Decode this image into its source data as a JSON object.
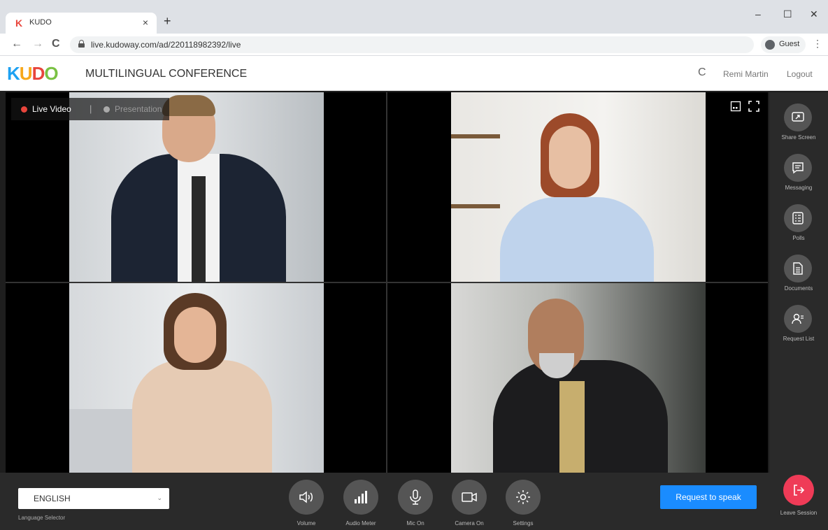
{
  "browser": {
    "tab_title": "KUDO",
    "tab_logo": "K",
    "new_tab": "+",
    "close_tab": "×",
    "url": "live.kudoway.com/ad/220118982392/live",
    "profile": "Guest",
    "minimize": "–",
    "maximize": "☐",
    "close_window": "✕",
    "back": "←",
    "forward": "→",
    "reload": "C",
    "menu": "⋮"
  },
  "header": {
    "logo": {
      "k": "K",
      "u": "U",
      "d": "D",
      "o": "O"
    },
    "title": "MULTILINGUAL CONFERENCE",
    "refresh": "C",
    "user": "Remi Martin",
    "logout": "Logout"
  },
  "view_modes": {
    "live": "Live Video",
    "separator": "|",
    "presentation": "Presentation"
  },
  "sidebar": {
    "items": [
      {
        "label": "Share Screen",
        "icon": "share-screen-icon"
      },
      {
        "label": "Messaging",
        "icon": "messaging-icon"
      },
      {
        "label": "Polls",
        "icon": "polls-icon"
      },
      {
        "label": "Documents",
        "icon": "documents-icon"
      },
      {
        "label": "Request List",
        "icon": "request-list-icon"
      }
    ]
  },
  "bottom": {
    "language_value": "ENGLISH",
    "language_caret": "⌄",
    "language_label": "Language Selector",
    "controls": [
      {
        "label": "Volume",
        "icon": "volume-icon"
      },
      {
        "label": "Audio Meter",
        "icon": "audio-meter-icon"
      },
      {
        "label": "Mic On",
        "icon": "mic-icon"
      },
      {
        "label": "Camera On",
        "icon": "camera-icon"
      },
      {
        "label": "Settings",
        "icon": "settings-icon"
      }
    ],
    "request_to_speak": "Request to speak",
    "leave_session": "Leave Session"
  },
  "colors": {
    "accent_blue": "#1a8cff",
    "leave_red": "#ef3b57",
    "live_dot": "#e8453c"
  }
}
